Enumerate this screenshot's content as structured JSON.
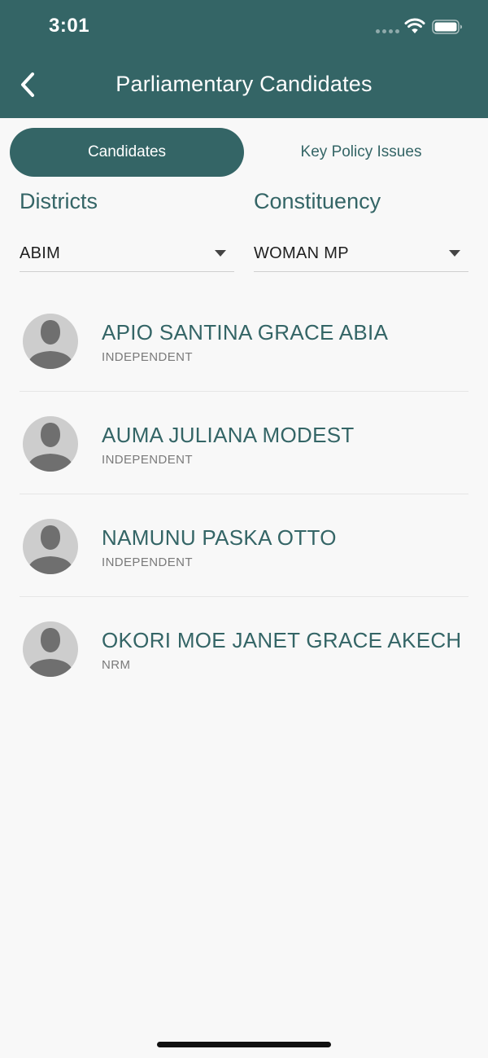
{
  "status_bar": {
    "time": "3:01"
  },
  "nav": {
    "title": "Parliamentary Candidates",
    "back_icon": "chevron-left-icon"
  },
  "tabs": [
    {
      "label": "Candidates",
      "active": true
    },
    {
      "label": "Key Policy Issues",
      "active": false
    }
  ],
  "filters": {
    "districts": {
      "label": "Districts",
      "value": "ABIM"
    },
    "constituency": {
      "label": "Constituency",
      "value": "WOMAN MP"
    }
  },
  "candidates": [
    {
      "name": "APIO SANTINA GRACE ABIA",
      "party": "INDEPENDENT"
    },
    {
      "name": "AUMA JULIANA MODEST",
      "party": "INDEPENDENT"
    },
    {
      "name": "NAMUNU PASKA OTTO",
      "party": "INDEPENDENT"
    },
    {
      "name": "OKORI MOE JANET GRACE AKECH",
      "party": "NRM"
    }
  ],
  "colors": {
    "primary": "#346566",
    "background": "#f8f8f8",
    "avatar_bg": "#cdcdcd",
    "avatar_fg": "#6f6f6f"
  }
}
